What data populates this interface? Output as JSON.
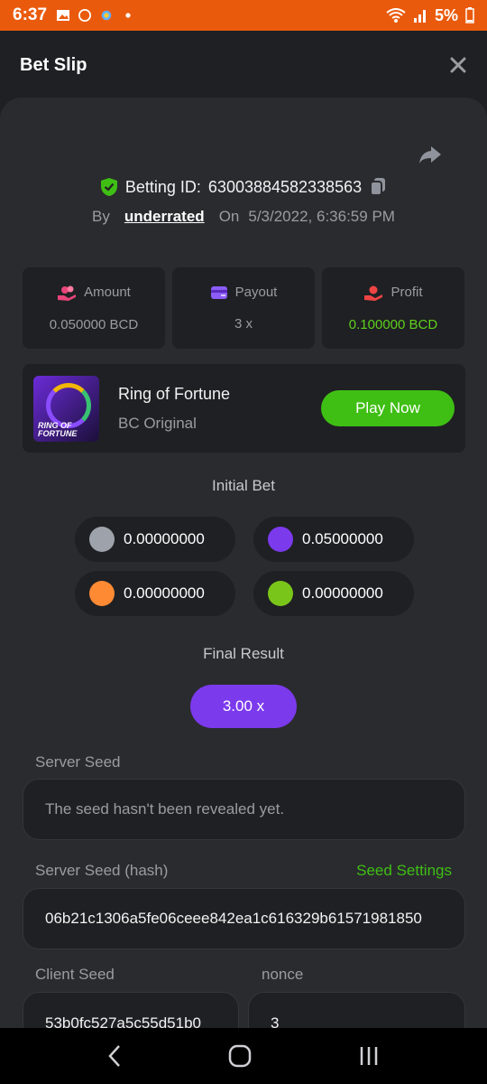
{
  "status": {
    "time": "6:37",
    "battery": "5%"
  },
  "header": {
    "title": "Bet Slip"
  },
  "bet": {
    "id_label": "Betting ID:",
    "id_value": "63003884582338563",
    "by_label": "By",
    "user": "underrated",
    "on_label": "On",
    "datetime": "5/3/2022, 6:36:59 PM"
  },
  "stats": [
    {
      "label": "Amount",
      "value": "0.050000 BCD"
    },
    {
      "label": "Payout",
      "value": "3 x"
    },
    {
      "label": "Profit",
      "value": "0.100000 BCD"
    }
  ],
  "game": {
    "name": "Ring of Fortune",
    "subtitle": "BC Original",
    "play_label": "Play Now",
    "thumb_label": "RING OF FORTUNE"
  },
  "initial_bet": {
    "title": "Initial Bet",
    "chips": [
      {
        "color": "#9ea3ab",
        "value": "0.00000000"
      },
      {
        "color": "#7c3aed",
        "value": "0.05000000"
      },
      {
        "color": "#ff8a34",
        "value": "0.00000000"
      },
      {
        "color": "#7ac51a",
        "value": "0.00000000"
      }
    ]
  },
  "final_result": {
    "title": "Final Result",
    "value": "3.00 x"
  },
  "server_seed": {
    "label": "Server Seed",
    "value": "The seed hasn't been revealed yet."
  },
  "server_seed_hash": {
    "label": "Server Seed (hash)",
    "link": "Seed Settings",
    "value": "06b21c1306a5fe06ceee842ea1c616329b61571981850"
  },
  "client_seed": {
    "label": "Client Seed",
    "value": "53b0fc527a5c55d51b0"
  },
  "nonce": {
    "label": "nonce",
    "value": "3"
  },
  "colors": {
    "accent_green": "#3fbf14",
    "accent_purple": "#7c3aed",
    "status_orange": "#ea5a0c"
  }
}
